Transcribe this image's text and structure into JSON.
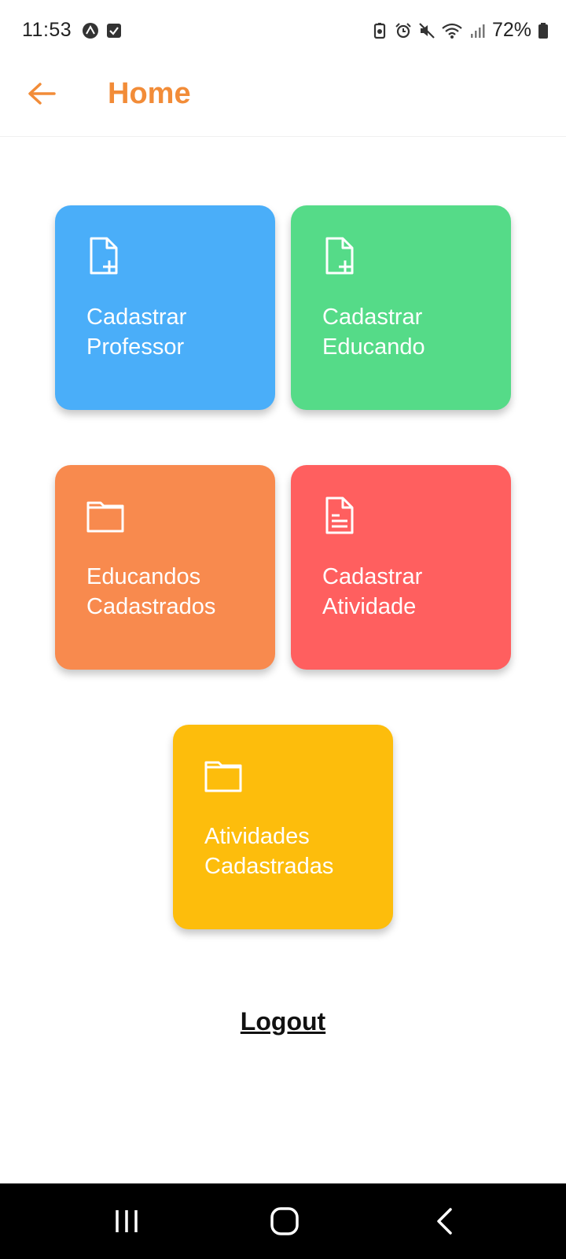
{
  "status_bar": {
    "time": "11:53",
    "battery": "72%",
    "left_icons": [
      "expo-icon",
      "checkbox-icon"
    ],
    "right_icons": [
      "battery-saver-icon",
      "alarm-icon",
      "mute-icon",
      "wifi-icon",
      "signal-icon",
      "battery-icon"
    ]
  },
  "header": {
    "title": "Home",
    "accent_color": "#F28C38"
  },
  "cards": [
    {
      "label": "Cadastrar\nProfessor",
      "icon": "file-plus-icon",
      "color": "#4AAEF9"
    },
    {
      "label": "Cadastrar\nEducando",
      "icon": "file-plus-icon",
      "color": "#55DB88"
    },
    {
      "label": "Educandos\nCadastrados",
      "icon": "folder-icon",
      "color": "#F88A4E"
    },
    {
      "label": "Cadastrar\nAtividade",
      "icon": "file-text-icon",
      "color": "#FF5F5F"
    },
    {
      "label": "Atividades\nCadastradas",
      "icon": "folder-icon",
      "color": "#FDBD0C"
    }
  ],
  "logout_label": "Logout",
  "nav": [
    "recent-apps-icon",
    "home-icon",
    "back-icon"
  ]
}
